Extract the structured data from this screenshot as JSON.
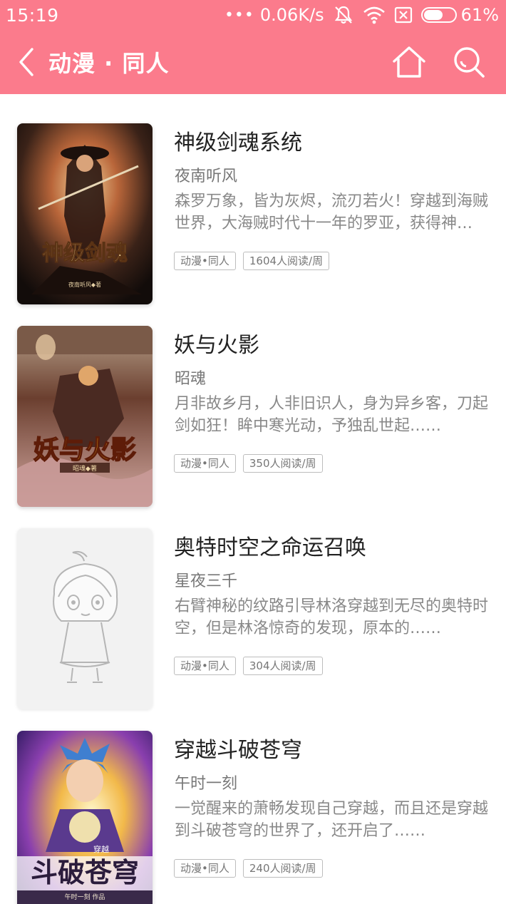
{
  "status_bar": {
    "time": "15:19",
    "dots": "•••",
    "speed": "0.06K/s",
    "battery": "61%",
    "battery_level": 0.61,
    "icons": [
      "mute-icon",
      "wifi-icon",
      "sim-icon",
      "battery-icon"
    ]
  },
  "header": {
    "title": "动漫 · 同人",
    "background": "#fb7b8c",
    "icons": [
      "back-icon",
      "home-icon",
      "search-icon"
    ]
  },
  "books": [
    {
      "title": "神级剑魂系统",
      "author": "夜南听风",
      "description": "森罗万象，皆为灰烬，流刃若火！穿越到海贼世界，大海贼时代十一年的罗亚，获得神级剑魂系统……",
      "tags": [
        "动漫•同人",
        "1604人阅读/周"
      ]
    },
    {
      "title": "妖与火影",
      "author": "昭魂",
      "description": "月非故乡月，人非旧识人，身为异乡客，刀起剑如狂！眸中寒光动，予独乱世起……",
      "tags": [
        "动漫•同人",
        "350人阅读/周"
      ]
    },
    {
      "title": "奥特时空之命运召唤",
      "author": "星夜三千",
      "description": "右臂神秘的纹路引导林洛穿越到无尽的奥特时空，但是林洛惊奇的发现，原本的……",
      "tags": [
        "动漫•同人",
        "304人阅读/周"
      ]
    },
    {
      "title": "穿越斗破苍穹",
      "author": "午时一刻",
      "description": "一觉醒来的萧畅发现自己穿越，而且还是穿越到斗破苍穹的世界了，还开启了……",
      "tags": [
        "动漫•同人",
        "240人阅读/周"
      ]
    }
  ],
  "covers": {
    "book1": {
      "art": "神级剑魂",
      "byline": "夜南听风◆著"
    },
    "book2": {
      "art": "妖与火影",
      "byline": "昭魂◆著"
    },
    "book3": {
      "art": "placeholder-avatar"
    },
    "book4": {
      "art": "斗破苍穹",
      "kicker": "穿越",
      "byline": "午时一刻 作品"
    }
  }
}
